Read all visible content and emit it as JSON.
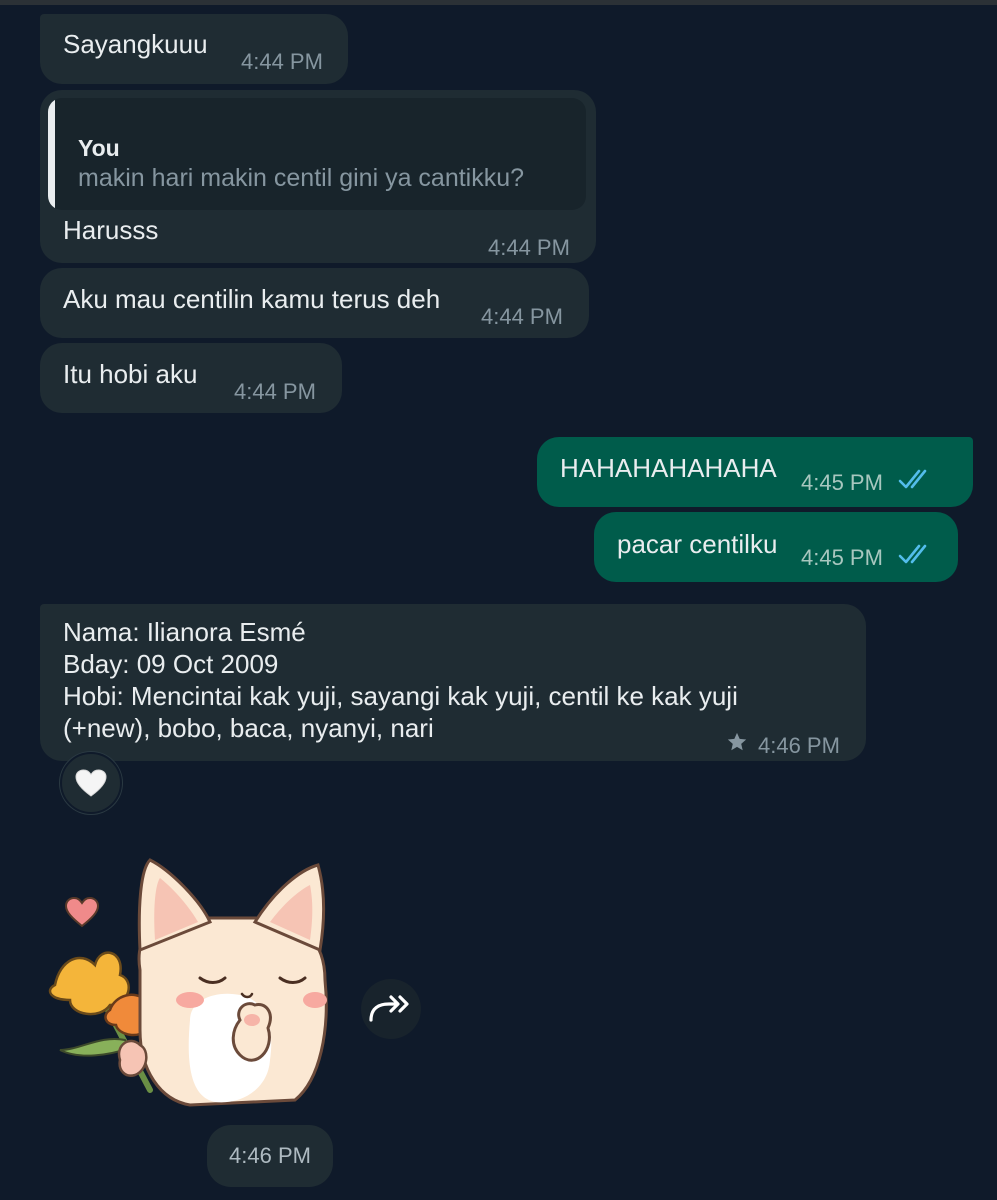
{
  "messages": [
    {
      "id": "m1",
      "direction": "incoming",
      "text": "Sayangkuuu",
      "time": "4:44 PM"
    },
    {
      "id": "m2",
      "direction": "incoming",
      "reply_to": {
        "author": "You",
        "text": "makin hari makin centil gini ya cantikku?"
      },
      "text": "Harusss",
      "time": "4:44 PM"
    },
    {
      "id": "m3",
      "direction": "incoming",
      "text": "Aku mau centilin kamu terus deh",
      "time": "4:44 PM"
    },
    {
      "id": "m4",
      "direction": "incoming",
      "text": "Itu hobi aku",
      "time": "4:44 PM"
    },
    {
      "id": "m5",
      "direction": "outgoing",
      "text": "HAHAHAHAHAHA",
      "time": "4:45 PM",
      "status": "read"
    },
    {
      "id": "m6",
      "direction": "outgoing",
      "text": "pacar centilku",
      "time": "4:45 PM",
      "status": "read"
    },
    {
      "id": "m7",
      "direction": "incoming",
      "lines": [
        "Nama: Ilianora Esmé",
        "Bday: 09 Oct 2009",
        "Hobi: Mencintai kak yuji, sayangi kak yuji, centil ke kak yuji",
        "(+new), bobo, baca, nyanyi, nari"
      ],
      "time": "4:46 PM",
      "starred": true,
      "reaction": "white-heart"
    },
    {
      "id": "m8",
      "direction": "incoming",
      "type": "sticker",
      "sticker": "cat-with-flowers",
      "time": "4:46 PM"
    }
  ],
  "icons": {
    "read_ticks": "double-check-icon",
    "star": "star-icon",
    "reaction": "white-heart-icon",
    "forward": "forward-icon"
  },
  "colors": {
    "background": "#0f1a2a",
    "incoming": "#1f2c33",
    "outgoing": "#005c4b",
    "read_ticks": "#53bdeb",
    "timestamp": "#8696a0"
  }
}
